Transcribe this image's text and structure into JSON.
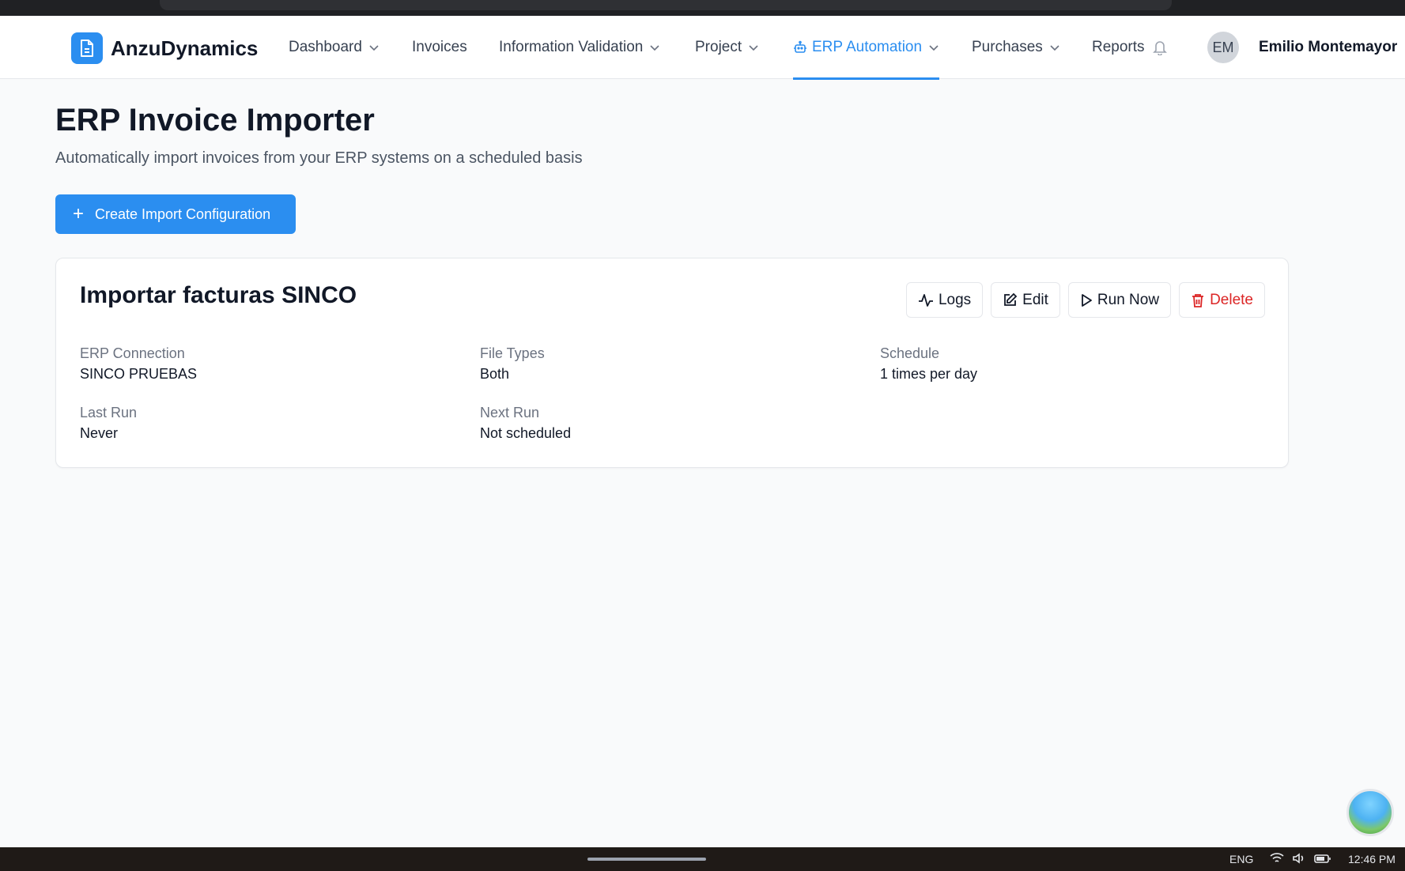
{
  "brand": {
    "name": "AnzuDynamics"
  },
  "nav": {
    "items": [
      {
        "label": "Dashboard"
      },
      {
        "label": "Invoices"
      },
      {
        "label": "Information Validation"
      },
      {
        "label": "Project"
      },
      {
        "label": "ERP Automation"
      },
      {
        "label": "Purchases"
      },
      {
        "label": "Reports"
      }
    ],
    "active": "ERP Automation",
    "accent_color": "#2b8ef0"
  },
  "user": {
    "initials": "EM",
    "name": "Emilio Montemayor"
  },
  "page": {
    "title": "ERP Invoice Importer",
    "subtitle": "Automatically import invoices from your ERP systems on a scheduled basis",
    "create_button": "Create Import Configuration"
  },
  "config_card": {
    "title": "Importar facturas SINCO",
    "actions": {
      "logs": "Logs",
      "edit": "Edit",
      "run_now": "Run Now",
      "delete": "Delete"
    },
    "fields": {
      "erp_connection": {
        "label": "ERP Connection",
        "value": "SINCO PRUEBAS"
      },
      "file_types": {
        "label": "File Types",
        "value": "Both"
      },
      "schedule": {
        "label": "Schedule",
        "value": "1 times per day"
      },
      "last_run": {
        "label": "Last Run",
        "value": "Never"
      },
      "next_run": {
        "label": "Next Run",
        "value": "Not scheduled"
      }
    },
    "delete_color": "#dc2626"
  },
  "taskbar": {
    "language": "ENG",
    "time": "12:46 PM"
  }
}
